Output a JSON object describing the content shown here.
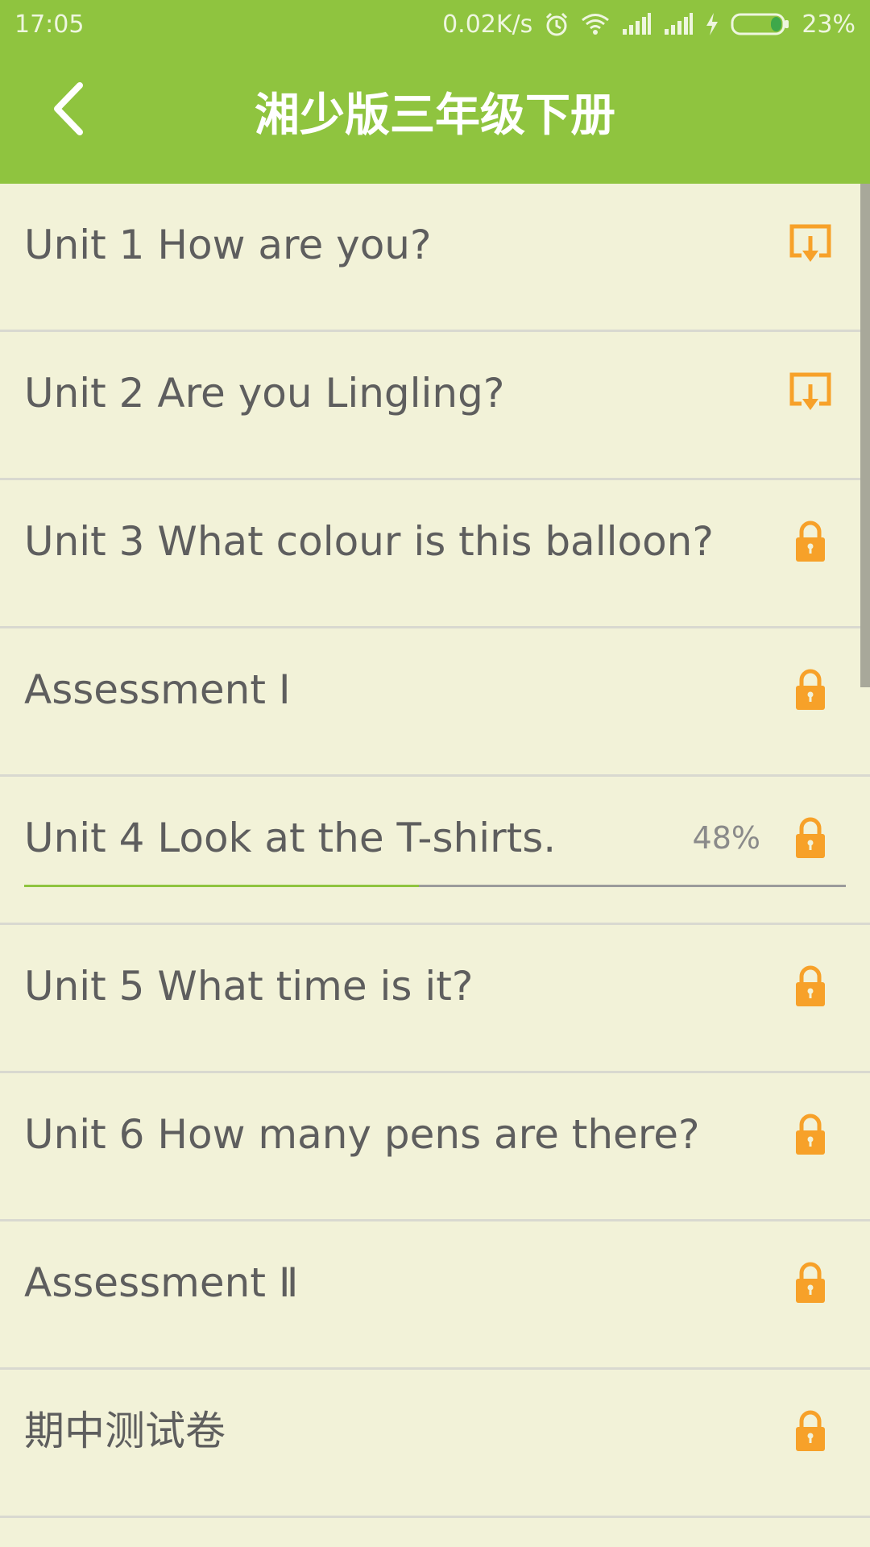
{
  "status_bar": {
    "time": "17:05",
    "speed": "0.02K/s",
    "battery_percent": "23%",
    "battery_level": 0.23,
    "icons": [
      "alarm-icon",
      "wifi-icon",
      "signal-icon",
      "signal-icon",
      "charging-icon",
      "battery-icon"
    ]
  },
  "app_bar": {
    "title": "湘少版三年级下册",
    "back_icon": "back-chevron-icon",
    "color": "#8fc43f"
  },
  "list": {
    "items": [
      {
        "label": "Unit 1 How are you?",
        "icon": "download-icon"
      },
      {
        "label": "Unit 2 Are you Lingling?",
        "icon": "download-icon"
      },
      {
        "label": "Unit 3 What colour is this balloon?",
        "icon": "lock-icon"
      },
      {
        "label": "Assessment Ⅰ",
        "icon": "lock-icon"
      },
      {
        "label": "Unit 4 Look at the T-shirts.",
        "icon": "lock-icon",
        "percent": "48%",
        "progress": 0.48
      },
      {
        "label": "Unit 5 What time is it?",
        "icon": "lock-icon"
      },
      {
        "label": "Unit 6 How many pens are there?",
        "icon": "lock-icon"
      },
      {
        "label": "Assessment Ⅱ",
        "icon": "lock-icon"
      },
      {
        "label": "期中测试卷",
        "icon": "lock-icon"
      }
    ]
  },
  "colors": {
    "accent": "#8fc43f",
    "background": "#f2f2d8",
    "icon_orange": "#f7a129",
    "text": "#5e5e5e"
  }
}
